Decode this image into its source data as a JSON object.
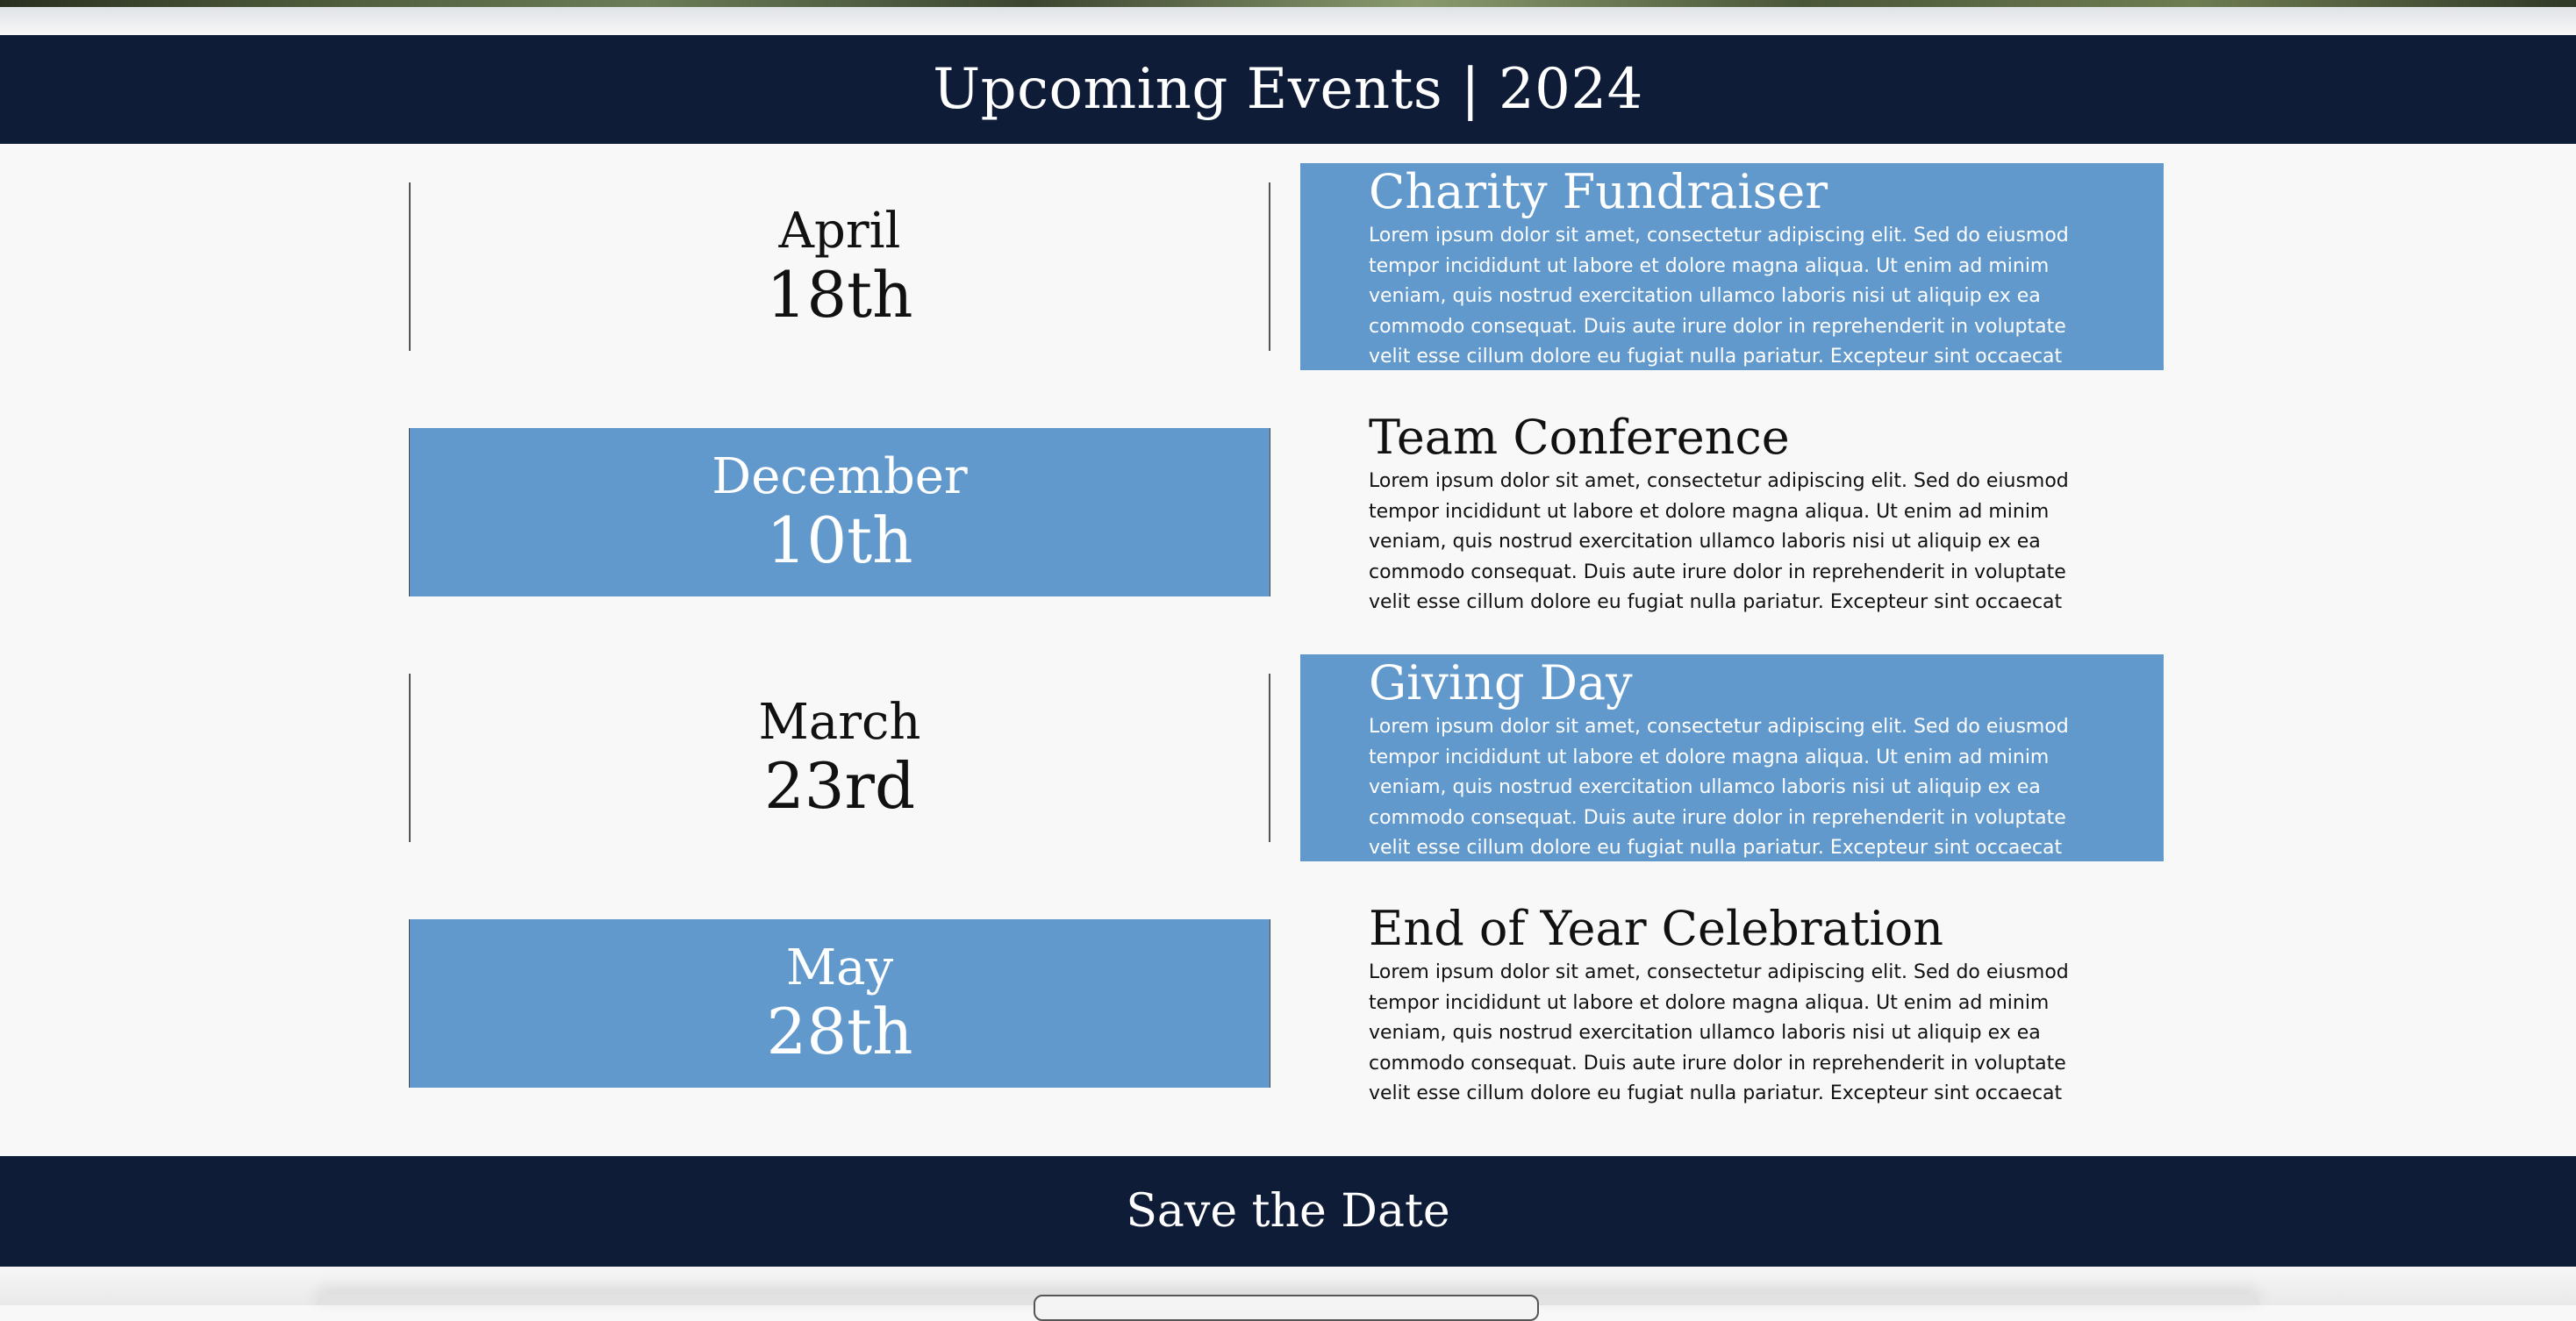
{
  "header": {
    "title": "Upcoming Events | 2024"
  },
  "events": [
    {
      "month": "April",
      "day": "18th",
      "title": "Charity Fundraiser",
      "description": "Lorem ipsum dolor sit amet, consectetur adipiscing elit. Sed do eiusmod tempor incididunt ut labore et dolore magna aliqua. Ut enim ad minim veniam, quis nostrud exercitation ullamco laboris nisi ut aliquip ex ea commodo consequat. Duis aute irure dolor in reprehenderit in voluptate velit esse cillum dolore eu fugiat nulla pariatur. Excepteur sint occaecat cupidatat non"
    },
    {
      "month": "December",
      "day": "10th",
      "title": "Team Conference",
      "description": "Lorem ipsum dolor sit amet, consectetur adipiscing elit. Sed do eiusmod tempor incididunt ut labore et dolore magna aliqua. Ut enim ad minim veniam, quis nostrud exercitation ullamco laboris nisi ut aliquip ex ea commodo consequat. Duis aute irure dolor in reprehenderit in voluptate velit esse cillum dolore eu fugiat nulla pariatur. Excepteur sint occaecat cupidatat non"
    },
    {
      "month": "March",
      "day": "23rd",
      "title": "Giving Day",
      "description": "Lorem ipsum dolor sit amet, consectetur adipiscing elit. Sed do eiusmod tempor incididunt ut labore et dolore magna aliqua. Ut enim ad minim veniam, quis nostrud exercitation ullamco laboris nisi ut aliquip ex ea commodo consequat. Duis aute irure dolor in reprehenderit in voluptate velit esse cillum dolore eu fugiat nulla pariatur. Excepteur sint occaecat cupidatat non"
    },
    {
      "month": "May",
      "day": "28th",
      "title": "End of Year Celebration",
      "description": "Lorem ipsum dolor sit amet, consectetur adipiscing elit. Sed do eiusmod tempor incididunt ut labore et dolore magna aliqua. Ut enim ad minim veniam, quis nostrud exercitation ullamco laboris nisi ut aliquip ex ea commodo consequat. Duis aute irure dolor in reprehenderit in voluptate velit esse cillum dolore eu fugiat nulla pariatur. Excepteur sint occaecat cupidatat non"
    }
  ],
  "footer": {
    "title": "Save the Date"
  },
  "colors": {
    "navy": "#0f1c38",
    "accent_blue": "#6199cd",
    "background": "#f8f8f8"
  }
}
